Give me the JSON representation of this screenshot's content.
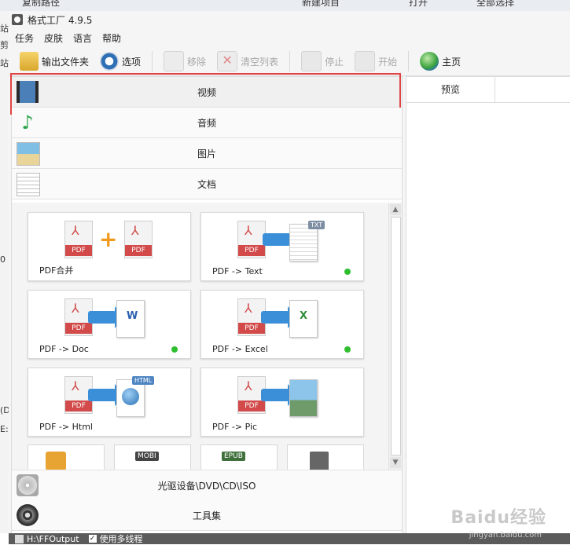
{
  "background_window": {
    "top_items": [
      "复制路径",
      "新建项目",
      "打开",
      "全部选择"
    ],
    "left_chars": [
      "站",
      "剪",
      "站",
      "0",
      "(D",
      "E:"
    ]
  },
  "window": {
    "title": "格式工厂 4.9.5"
  },
  "menu": [
    "任务",
    "皮肤",
    "语言",
    "帮助"
  ],
  "toolbar": {
    "output_folder": "输出文件夹",
    "options": "选项",
    "remove": "移除",
    "clear_list": "清空列表",
    "stop": "停止",
    "start": "开始",
    "home": "主页"
  },
  "categories": {
    "video": "视频",
    "audio": "音频",
    "image": "图片",
    "document": "文档",
    "optical": "光驱设备\\DVD\\CD\\ISO",
    "tools": "工具集"
  },
  "doc_tiles": [
    {
      "label": "PDF合并",
      "status_dot": false
    },
    {
      "label": "PDF -> Text",
      "status_dot": true
    },
    {
      "label": "PDF -> Doc",
      "status_dot": true
    },
    {
      "label": "PDF -> Excel",
      "status_dot": true
    },
    {
      "label": "PDF -> Html",
      "status_dot": false
    },
    {
      "label": "PDF -> Pic",
      "status_dot": false
    }
  ],
  "tile_art": {
    "pdf": "PDF",
    "txt": "TXT",
    "word": "W",
    "excel": "X",
    "html": "HTML",
    "mobi": "MOBI",
    "epub": "EPUB"
  },
  "preview": {
    "header": "预览"
  },
  "statusbar": {
    "path": "H:\\FFOutput",
    "multithread": "使用多线程"
  },
  "watermark": {
    "brand": "Baidu经验",
    "url": "jingyan.baidu.com"
  },
  "colors": {
    "highlight": "#e04343",
    "status_dot": "#2fbe2f",
    "pdf_red": "#d24a4a",
    "arrow_blue": "#3a8fd8"
  }
}
